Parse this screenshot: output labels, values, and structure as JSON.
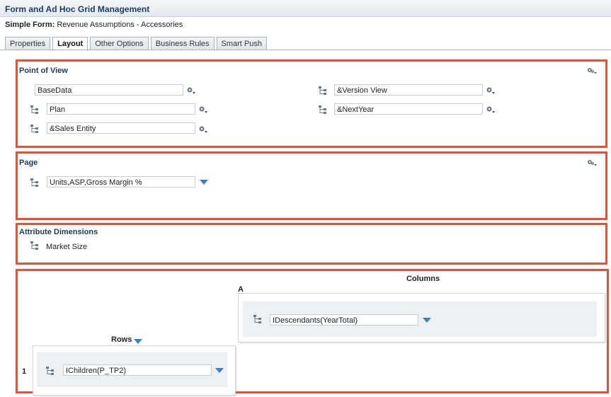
{
  "header": {
    "title": "Form and Ad Hoc Grid Management",
    "form_label": "Simple Form:",
    "form_name": "Revenue Assumptions - Accessories"
  },
  "tabs": [
    {
      "label": "Properties",
      "active": false
    },
    {
      "label": "Layout",
      "active": true
    },
    {
      "label": "Other Options",
      "active": false
    },
    {
      "label": "Business Rules",
      "active": false
    },
    {
      "label": "Smart Push",
      "active": false
    }
  ],
  "point_of_view": {
    "title": "Point of View",
    "members": [
      "BaseData",
      "Plan",
      "&Sales Entity",
      "&Version View",
      "&NextYear"
    ]
  },
  "page": {
    "title": "Page",
    "members": [
      "Units,ASP,Gross Margin %"
    ]
  },
  "attribute_dimensions": {
    "title": "Attribute Dimensions",
    "items": [
      "Market Size"
    ]
  },
  "layout_grid": {
    "columns_label": "Columns",
    "column_letter": "A",
    "column_member": "IDescendants(YearTotal)",
    "rows_label": "Rows",
    "row_number": "1",
    "row_member": "IChildren(P_TP2)"
  },
  "colors": {
    "accent_border": "#d9583b",
    "title_text": "#1d3b5f",
    "dropdown": "#3b7fc4"
  },
  "icons": {
    "dimension": "dimension-tree-icon",
    "member_selector": "member-selector-icon",
    "gear_menu": "gear-menu-icon",
    "dropdown": "dropdown-arrow-icon"
  }
}
